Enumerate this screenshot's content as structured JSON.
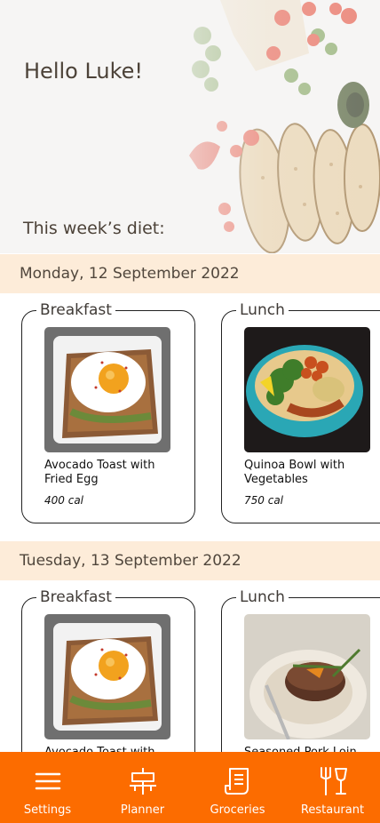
{
  "header": {
    "greeting": "Hello Luke!",
    "week_title": "This week’s diet:"
  },
  "days": [
    {
      "date": "Monday, 12 September 2022",
      "meals": [
        {
          "type": "Breakfast",
          "dish": "Avocado Toast with Fried Egg",
          "calories": "400 cal",
          "image": "avocado-toast-egg"
        },
        {
          "type": "Lunch",
          "dish": "Quinoa Bowl with Vegetables",
          "calories": "750 cal",
          "image": "quinoa-bowl"
        }
      ]
    },
    {
      "date": "Tuesday, 13 September 2022",
      "meals": [
        {
          "type": "Breakfast",
          "dish": "Avocado Toast with",
          "image": "avocado-toast-egg"
        },
        {
          "type": "Lunch",
          "dish": "Seasoned Pork Loin",
          "image": "seasoned-steak"
        }
      ]
    }
  ],
  "nav": [
    {
      "label": "Settings",
      "icon": "menu-icon"
    },
    {
      "label": "Planner",
      "icon": "planner-icon"
    },
    {
      "label": "Groceries",
      "icon": "receipt-icon"
    },
    {
      "label": "Restaurant",
      "icon": "restaurant-icon"
    }
  ],
  "colors": {
    "accent": "#fc6c00",
    "day_header_bg": "#fdecd9",
    "text": "#4c4238"
  }
}
